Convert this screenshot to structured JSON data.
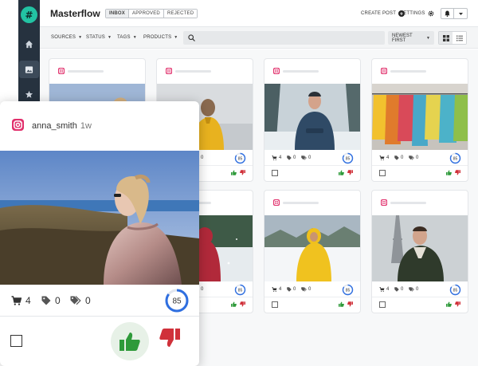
{
  "app": {
    "title": "Masterflow"
  },
  "tabs": [
    {
      "label": "INBOX",
      "active": true
    },
    {
      "label": "APPROVED",
      "active": false
    },
    {
      "label": "REJECTED",
      "active": false
    }
  ],
  "header": {
    "create_post": "CREATE POST",
    "settings": "SETTINGS"
  },
  "filters": {
    "sources": "SOURCES",
    "status": "STATUS",
    "tags": "TAGS",
    "products": "PRODUCTS",
    "sort": "NEWEST FIRST"
  },
  "colors": {
    "sidebar": "#26323f",
    "accent": "#22c3a3",
    "instagram": "#e1306c",
    "approve": "#2e9a3a",
    "reject": "#d0313a",
    "score_ring": "#2f6fe0"
  },
  "icons": {
    "sidebar": [
      "home-icon",
      "image-icon",
      "star-icon"
    ],
    "header": [
      "plus-circle-icon",
      "gear-icon",
      "bell-icon",
      "caret-down-icon"
    ],
    "filters": [
      "search-icon",
      "grid-view-icon",
      "list-view-icon"
    ],
    "card": [
      "instagram-icon",
      "cart-icon",
      "tag-icon",
      "tags-icon",
      "thumbs-up-icon",
      "thumbs-down-icon"
    ]
  },
  "cards": [
    {
      "scene": "coast-woman",
      "products": "4",
      "tags": "0",
      "labels": "0",
      "score": "85",
      "score_pct": 0.85
    },
    {
      "scene": "yellow-jacket-fog",
      "products": "4",
      "tags": "0",
      "labels": "0",
      "score": "85",
      "score_pct": 0.85
    },
    {
      "scene": "winter-man",
      "products": "4",
      "tags": "0",
      "labels": "0",
      "score": "85",
      "score_pct": 0.85
    },
    {
      "scene": "clothing-rack",
      "products": "4",
      "tags": "0",
      "labels": "0",
      "score": "85",
      "score_pct": 0.85
    },
    {
      "scene": "snow-forest",
      "products": "4",
      "tags": "0",
      "labels": "0",
      "score": "85",
      "score_pct": 0.85
    },
    {
      "scene": "red-hood-snow",
      "products": "4",
      "tags": "0",
      "labels": "0",
      "score": "85",
      "score_pct": 0.85
    },
    {
      "scene": "yellow-parka-snow",
      "products": "4",
      "tags": "0",
      "labels": "0",
      "score": "85",
      "score_pct": 0.85
    },
    {
      "scene": "paris-man",
      "products": "4",
      "tags": "0",
      "labels": "0",
      "score": "85",
      "score_pct": 0.85
    }
  ],
  "featured": {
    "username": "anna_smith",
    "time": "1w",
    "products": "4",
    "tags": "0",
    "labels": "0",
    "score": "85",
    "score_pct": 0.85
  }
}
